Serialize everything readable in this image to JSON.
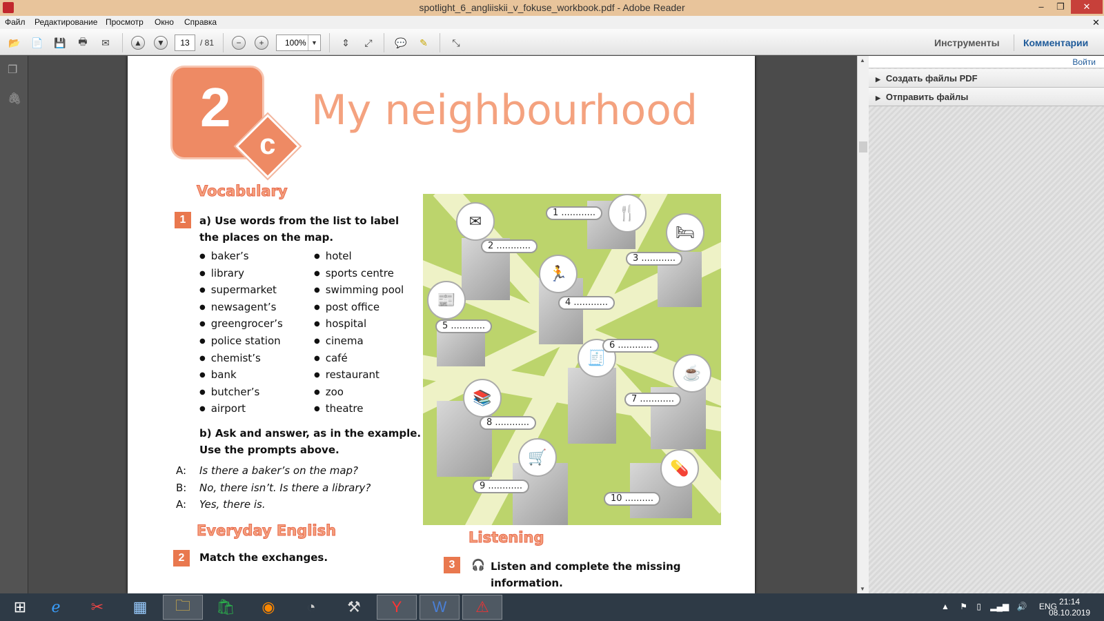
{
  "window": {
    "title": "spotlight_6_angliiskii_v_fokuse_workbook.pdf - Adobe Reader",
    "minimize": "–",
    "restore": "❐",
    "close": "✕",
    "doc_close": "✕"
  },
  "menu": [
    "Файл",
    "Редактирование",
    "Просмотр",
    "Окно",
    "Справка"
  ],
  "toolbar": {
    "page_current": "13",
    "page_total": "/ 81",
    "zoom": "100%",
    "tools": "Инструменты",
    "comments": "Комментарии"
  },
  "right_panel": {
    "sign_in": "Войти",
    "items": [
      "Создать файлы PDF",
      "Отправить файлы"
    ]
  },
  "doc": {
    "unit_number": "2",
    "unit_letter": "c",
    "title": "My neighbourhood",
    "section_vocab": "Vocabulary",
    "ex1_num": "1",
    "ex1a": "a) Use words from the list to label the places on the map.",
    "words_left": [
      "baker’s",
      "library",
      "supermarket",
      "newsagent’s",
      "greengrocer’s",
      "police station",
      "chemist’s",
      "bank",
      "butcher’s",
      "airport"
    ],
    "words_right": [
      "hotel",
      "sports centre",
      "swimming pool",
      "post office",
      "hospital",
      "cinema",
      "café",
      "restaurant",
      "zoo",
      "theatre"
    ],
    "ex1b": "b) Ask and answer, as in the example. Use the prompts above.",
    "dialogue": [
      {
        "speaker": "A:",
        "line": "Is there a baker’s on the map?"
      },
      {
        "speaker": "B:",
        "line": "No, there isn’t. Is there a library?"
      },
      {
        "speaker": "A:",
        "line": "Yes, there is."
      }
    ],
    "section_everyday": "Everyday English",
    "ex2_num": "2",
    "ex2": "Match the exchanges.",
    "section_listening": "Listening",
    "ex3_num": "3",
    "ex3": "Listen and complete the missing information.",
    "map_labels": [
      "1 ............",
      "2 ............",
      "3 ............",
      "4 ............",
      "5 ............",
      "6 ............",
      "7 ............",
      "8 ............",
      "9 ............",
      "10 .........."
    ]
  },
  "taskbar": {
    "lang": "ENG",
    "time": "21:14",
    "date": "08.10.2019"
  }
}
